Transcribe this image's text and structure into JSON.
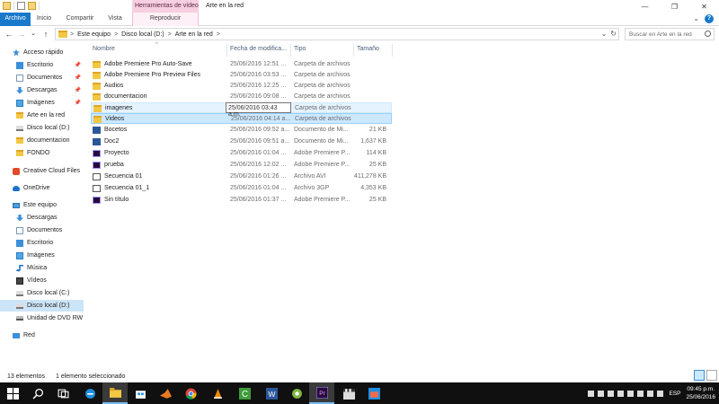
{
  "window": {
    "title": "Arte en la red",
    "context_tab_group": "Herramientas de vídeo",
    "minimize": "—",
    "maximize": "❐",
    "close": "✕"
  },
  "ribbon": {
    "tabs": [
      {
        "label": "Archivo",
        "active": true
      },
      {
        "label": "Inicio"
      },
      {
        "label": "Compartir"
      },
      {
        "label": "Vista"
      },
      {
        "label": "Reproducir",
        "context": true
      }
    ],
    "expand_glyph": "⌄",
    "help_glyph": "?"
  },
  "address": {
    "back": "←",
    "forward": "→",
    "recent": "⌄",
    "up": "↑",
    "crumbs": [
      "Este equipo",
      "Disco local (D:)",
      "Arte en la red"
    ],
    "separator": ">",
    "dropdown": "⌄",
    "refresh": "↻",
    "search_placeholder": "Buscar en Arte en la red"
  },
  "nav": {
    "items": [
      {
        "label": "Acceso rápido",
        "icon": "star-icon",
        "pinned": false,
        "indent": 0
      },
      {
        "label": "Escritorio",
        "icon": "desktop-icon",
        "pinned": true,
        "indent": 1
      },
      {
        "label": "Documentos",
        "icon": "documents-icon",
        "pinned": true,
        "indent": 1
      },
      {
        "label": "Descargas",
        "icon": "downloads-icon",
        "pinned": true,
        "indent": 1
      },
      {
        "label": "Imágenes",
        "icon": "pictures-icon",
        "pinned": true,
        "indent": 1
      },
      {
        "label": "Arte en la red",
        "icon": "folder-icon",
        "pinned": false,
        "indent": 1
      },
      {
        "label": "Disco local (D:)",
        "icon": "drive-icon",
        "pinned": false,
        "indent": 1
      },
      {
        "label": "documentacion",
        "icon": "folder-icon",
        "pinned": false,
        "indent": 1
      },
      {
        "label": "FONDO",
        "icon": "folder-icon",
        "pinned": false,
        "indent": 1
      },
      {
        "label": "Creative Cloud Files",
        "icon": "creative-cloud-icon",
        "pinned": false,
        "indent": 0
      },
      {
        "label": "OneDrive",
        "icon": "onedrive-icon",
        "pinned": false,
        "indent": 0
      },
      {
        "label": "Este equipo",
        "icon": "this-pc-icon",
        "pinned": false,
        "indent": 0
      },
      {
        "label": "Descargas",
        "icon": "downloads-icon",
        "pinned": false,
        "indent": 1
      },
      {
        "label": "Documentos",
        "icon": "documents-icon",
        "pinned": false,
        "indent": 1
      },
      {
        "label": "Escritorio",
        "icon": "desktop-icon",
        "pinned": false,
        "indent": 1
      },
      {
        "label": "Imágenes",
        "icon": "pictures-icon",
        "pinned": false,
        "indent": 1
      },
      {
        "label": "Música",
        "icon": "music-icon",
        "pinned": false,
        "indent": 1
      },
      {
        "label": "Vídeos",
        "icon": "videos-icon",
        "pinned": false,
        "indent": 1
      },
      {
        "label": "Disco local (C:)",
        "icon": "drive-icon",
        "pinned": false,
        "indent": 1
      },
      {
        "label": "Disco local (D:)",
        "icon": "drive-icon",
        "pinned": false,
        "indent": 1,
        "selected": true
      },
      {
        "label": "Unidad de DVD RW",
        "icon": "dvd-drive-icon",
        "pinned": false,
        "indent": 1
      },
      {
        "label": "Red",
        "icon": "network-icon",
        "pinned": false,
        "indent": 0
      }
    ],
    "pin_glyph": "📌"
  },
  "columns": {
    "name": "Nombre",
    "date": "Fecha de modifica...",
    "type": "Tipo",
    "size": "Tamaño",
    "sort_glyph": "^"
  },
  "files": [
    {
      "name": "Adobe Premiere Pro Auto-Save",
      "date": "25/06/2016 12:51 ...",
      "type": "Carpeta de archivos",
      "size": "",
      "icon": "folder"
    },
    {
      "name": "Adobe Premiere Pro Preview Files",
      "date": "25/06/2016 03:53 ...",
      "type": "Carpeta de archivos",
      "size": "",
      "icon": "folder"
    },
    {
      "name": "Audios",
      "date": "25/06/2016 12:25 ...",
      "type": "Carpeta de archivos",
      "size": "",
      "icon": "folder"
    },
    {
      "name": "documentacion",
      "date": "25/06/2016 09:08 ...",
      "type": "Carpeta de archivos",
      "size": "",
      "icon": "folder"
    },
    {
      "name": "imagenes",
      "date": "",
      "type": "Carpeta de archivos",
      "size": "",
      "icon": "folder",
      "state": "hover"
    },
    {
      "name": "Videos",
      "date": "25/06/2016 04:14 a...",
      "type": "Carpeta de archivos",
      "size": "",
      "icon": "folder",
      "state": "selected"
    },
    {
      "name": "Bocetos",
      "date": "25/06/2016 09:52 a...",
      "type": "Documento de Mi...",
      "size": "21 KB",
      "icon": "word"
    },
    {
      "name": "Doc2",
      "date": "25/06/2016 09:51 a...",
      "type": "Documento de Mi...",
      "size": "1,637 KB",
      "icon": "word"
    },
    {
      "name": "Proyecto",
      "date": "25/06/2016 01:04 ...",
      "type": "Adobe Premiere P...",
      "size": "114 KB",
      "icon": "premiere"
    },
    {
      "name": "prueba",
      "date": "25/06/2016 12:02 ...",
      "type": "Adobe Premiere P...",
      "size": "25 KB",
      "icon": "premiere"
    },
    {
      "name": "Secuencia 01",
      "date": "25/06/2016 01:26 ...",
      "type": "Archivo AVI",
      "size": "411,278 KB",
      "icon": "avi"
    },
    {
      "name": "Secuencia 01_1",
      "date": "25/06/2016 01:04 ...",
      "type": "Archivo 3GP",
      "size": "4,353 KB",
      "icon": "3gp"
    },
    {
      "name": "Sin título",
      "date": "25/06/2016 01:37 ...",
      "type": "Adobe Premiere P...",
      "size": "25 KB",
      "icon": "premiere"
    }
  ],
  "tooltip": "25/06/2016 03:43 a.m.",
  "status": {
    "count": "13 elementos",
    "selection": "1 elemento seleccionado"
  },
  "taskbar": {
    "items": [
      "windows-start-icon",
      "search-icon",
      "task-view-icon",
      "edge-icon",
      "file-explorer-icon",
      "store-icon",
      "matlab-icon",
      "chrome-icon",
      "vlc-icon",
      "camtasia-icon",
      "word-icon",
      "snipping-icon",
      "premiere-icon",
      "clapper-icon",
      "photos-icon"
    ],
    "active_index": 4,
    "language": "ESP",
    "time": "09:45 p.m.",
    "date": "25/06/2016"
  },
  "colors": {
    "accent": "#1979ca",
    "selection": "#cce8ff",
    "folder": "#f2c744",
    "taskbar": "#101010"
  }
}
